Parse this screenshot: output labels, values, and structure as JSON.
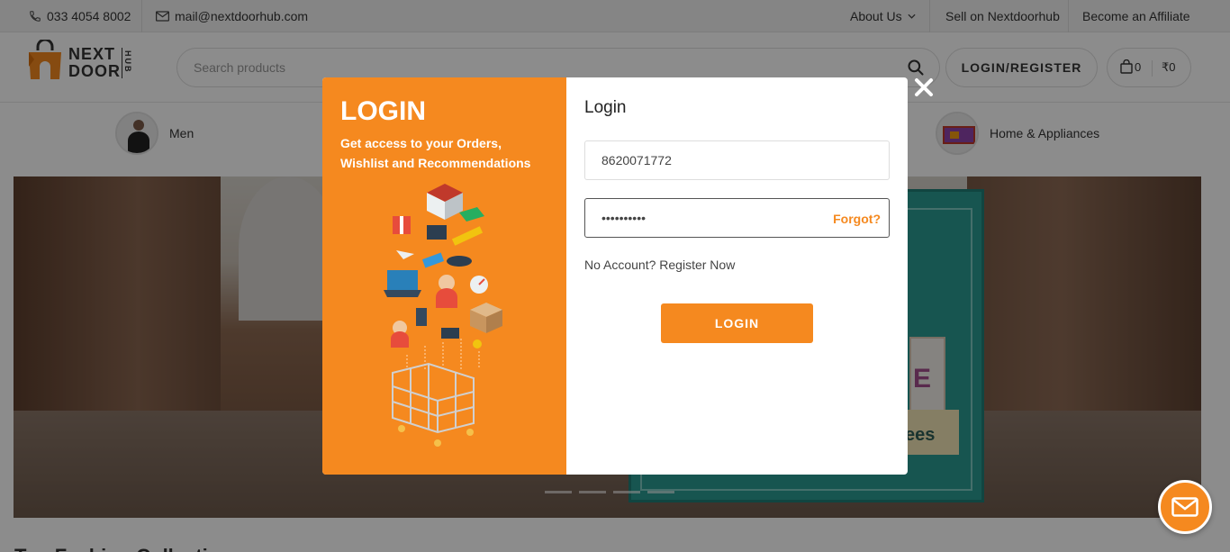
{
  "topbar": {
    "phone": "033 4054 8002",
    "email": "mail@nextdoorhub.com",
    "about": "About Us",
    "sell": "Sell on Nextdoorhub",
    "affiliate": "Become an Affiliate"
  },
  "header": {
    "logo_line1": "NEXT",
    "logo_line2": "DOOR",
    "logo_hub": "HUB",
    "search_placeholder": "Search products",
    "login_register": "LOGIN/REGISTER",
    "cart_count": "0",
    "cart_total": "₹0"
  },
  "categories": [
    {
      "label": "Men"
    },
    {
      "label": "Home & Appliances"
    }
  ],
  "hero": {
    "card_letter": "E",
    "card_text": "ees"
  },
  "section": {
    "title": "Top Fashion Collection"
  },
  "modal": {
    "left_title": "LOGIN",
    "left_subtitle": "Get access to your Orders, Wishlist and Recommendations",
    "right_title": "Login",
    "phone_value": "8620071772",
    "password_value": "••••••••••",
    "forgot": "Forgot?",
    "no_account": "No Account? Register Now",
    "login_button": "LOGIN"
  },
  "colors": {
    "accent": "#f5891f",
    "overlay": "rgba(0,0,0,0.45)"
  },
  "icons": [
    "phone-icon",
    "mail-icon",
    "chevron-down-icon",
    "search-icon",
    "shopping-bag-icon",
    "close-icon",
    "envelope-icon"
  ]
}
